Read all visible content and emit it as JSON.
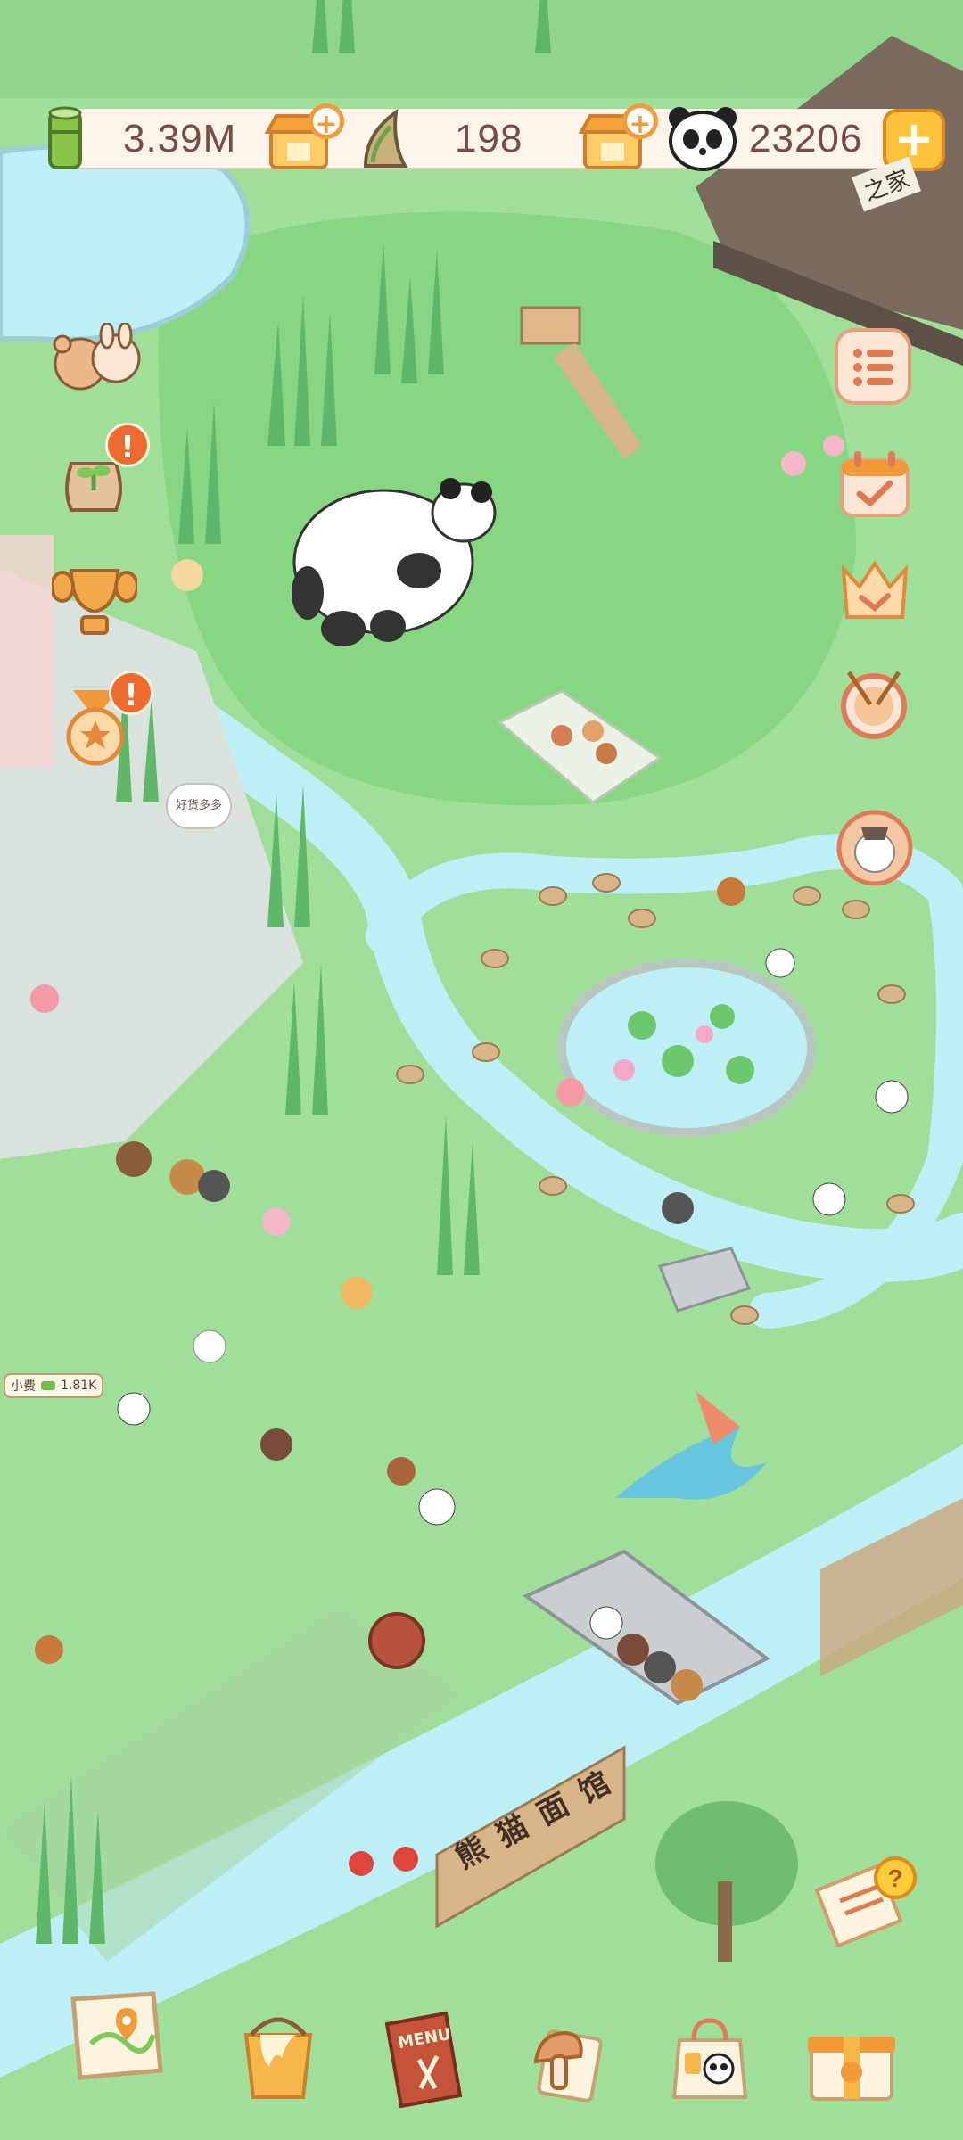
{
  "resources": {
    "bamboo_amount": "3.39M",
    "shoot_amount": "198",
    "panda_coins": "23206"
  },
  "bubble_text": "好货多多",
  "tip": {
    "label": "小费",
    "amount": "1.81K"
  },
  "restaurant_sign": "熊猫面馆",
  "menu_label": "MENU",
  "temple_sign": "之家",
  "colors": {
    "grass": "#9fdf9a",
    "river": "#bdf0f6",
    "accent_orange": "#f29a3a",
    "alert_orange": "#ee6a2f",
    "text_brown": "#7a4b43"
  },
  "icons": {
    "left_side": [
      "bears-icon",
      "seed-bag-icon",
      "trophy-icon",
      "medal-icon"
    ],
    "right_side": [
      "list-menu-icon",
      "calendar-check-icon",
      "crown-icon",
      "drum-icon",
      "character-portrait-icon",
      "help-notepad-icon"
    ],
    "bottom": [
      "map-icon",
      "paint-bucket-icon",
      "menu-book-icon",
      "mushroom-scroll-icon",
      "shopping-bag-icon",
      "gift-box-icon"
    ]
  }
}
